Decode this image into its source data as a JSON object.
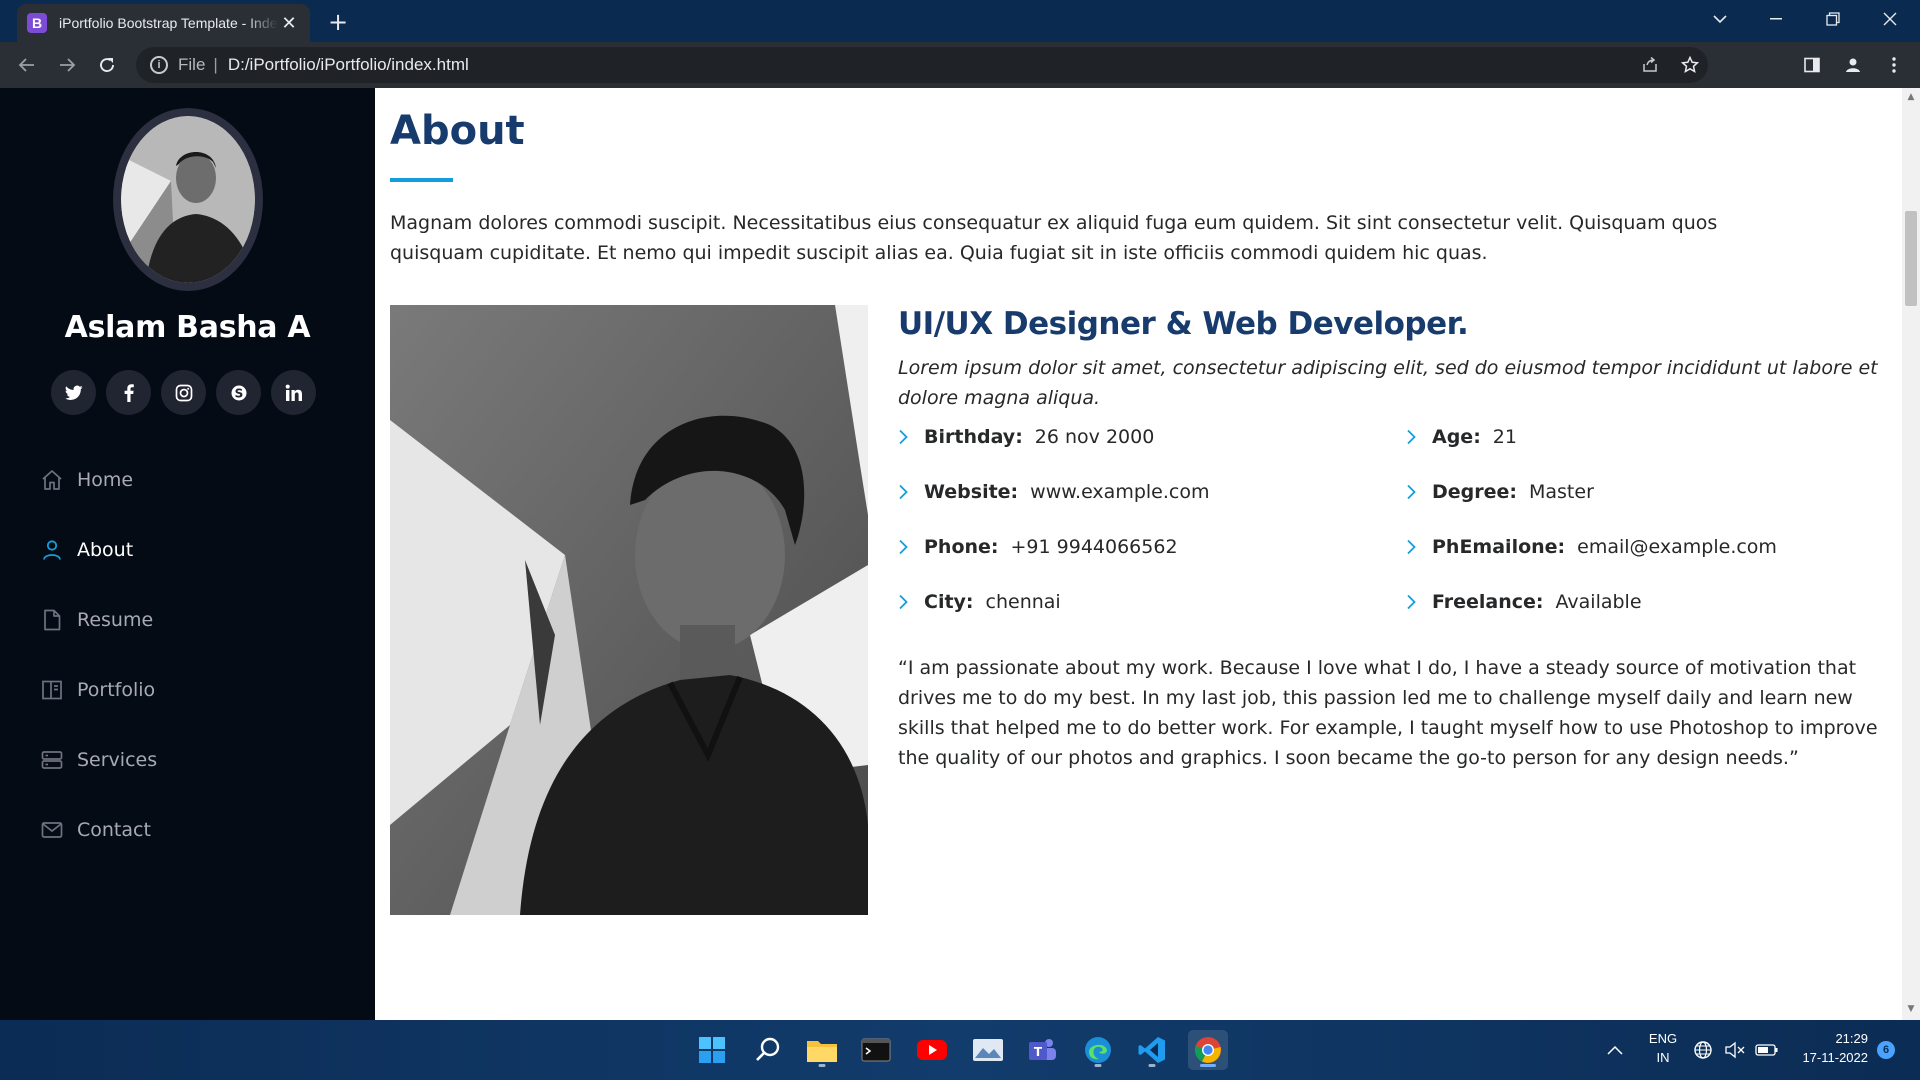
{
  "browser": {
    "tab_title": "iPortfolio Bootstrap Template - Index",
    "tab_favicon": "B",
    "address_scheme": "File",
    "address_url": "D:/iPortfolio/iPortfolio/index.html"
  },
  "sidebar": {
    "name": "Aslam Basha A",
    "socials": [
      "twitter-icon",
      "facebook-icon",
      "instagram-icon",
      "skype-icon",
      "linkedin-icon"
    ],
    "nav": [
      {
        "label": "Home",
        "icon": "home-icon",
        "active": false
      },
      {
        "label": "About",
        "icon": "person-icon",
        "active": true
      },
      {
        "label": "Resume",
        "icon": "file-icon",
        "active": false
      },
      {
        "label": "Portfolio",
        "icon": "book-icon",
        "active": false
      },
      {
        "label": "Services",
        "icon": "server-icon",
        "active": false
      },
      {
        "label": "Contact",
        "icon": "envelope-icon",
        "active": false
      }
    ]
  },
  "about": {
    "title": "About",
    "intro": "Magnam dolores commodi suscipit. Necessitatibus eius consequatur ex aliquid fuga eum quidem. Sit sint consectetur velit. Quisquam quos quisquam cupiditate. Et nemo qui impedit suscipit alias ea. Quia fugiat sit in iste officiis commodi quidem hic quas.",
    "role": "UI/UX Designer & Web Developer.",
    "tagline": "Lorem ipsum dolor sit amet, consectetur adipiscing elit, sed do eiusmod tempor incididunt ut labore et dolore magna aliqua.",
    "facts_left": [
      {
        "label": "Birthday:",
        "value": "26 nov 2000"
      },
      {
        "label": "Website:",
        "value": "www.example.com"
      },
      {
        "label": "Phone:",
        "value": "+91 9944066562"
      },
      {
        "label": "City:",
        "value": "chennai"
      }
    ],
    "facts_right": [
      {
        "label": "Age:",
        "value": "21"
      },
      {
        "label": "Degree:",
        "value": "Master"
      },
      {
        "label": "PhEmailone:",
        "value": "email@example.com"
      },
      {
        "label": "Freelance:",
        "value": "Available"
      }
    ],
    "quote": "“I am passionate about my work. Because I love what I do, I have a steady source of motivation that drives me to do my best. In my last job, this passion led me to challenge myself daily and learn new skills that helped me to do better work. For example, I taught myself how to use Photoshop to improve the quality of our photos and graphics. I soon became the go-to person for any design needs.”"
  },
  "taskbar": {
    "lang_top": "ENG",
    "lang_bottom": "IN",
    "time": "21:29",
    "date": "17-11-2022",
    "notification_count": "6"
  },
  "colors": {
    "accent": "#149ddd",
    "heading": "#173b6c",
    "sidebar_bg": "#040b14"
  }
}
